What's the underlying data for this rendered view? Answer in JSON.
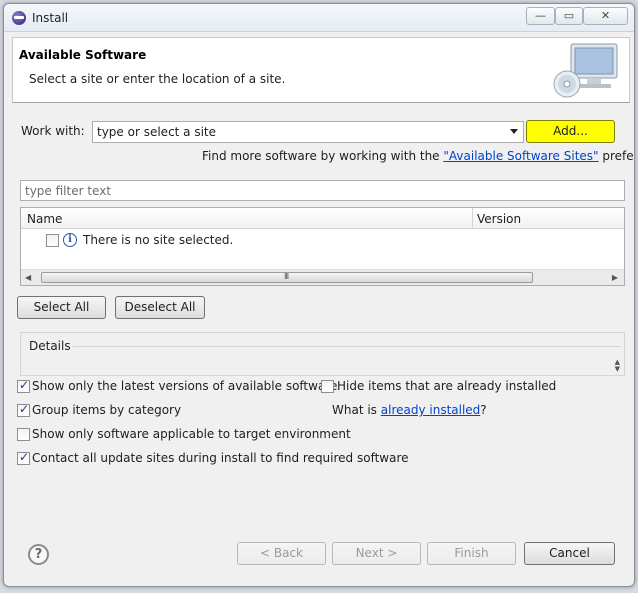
{
  "window": {
    "title": "Install",
    "minimize_glyph": "—",
    "maximize_glyph": "▭",
    "close_glyph": "✕"
  },
  "header": {
    "title": "Available Software",
    "description": "Select a site or enter the location of a site."
  },
  "work_with": {
    "label": "Work with:",
    "value": "type or select a site",
    "add_button": "Add...",
    "hint_prefix": "Find more software by working with the ",
    "hint_link": "\"Available Software Sites\"",
    "hint_suffix": " preferences."
  },
  "filter": {
    "placeholder": "type filter text"
  },
  "table": {
    "columns": [
      "Name",
      "Version"
    ],
    "empty_message": "There is no site selected.",
    "scroll_grip": "III"
  },
  "selection_buttons": {
    "select_all": "Select All",
    "deselect_all": "Deselect All"
  },
  "details": {
    "label": "Details"
  },
  "options": {
    "latest_versions": {
      "label": "Show only the latest versions of available software",
      "checked": true
    },
    "hide_installed": {
      "label": "Hide items that are already installed",
      "checked": false
    },
    "group_by_category": {
      "label": "Group items by category",
      "checked": true
    },
    "what_is_prefix": "What is ",
    "what_is_link": "already installed",
    "what_is_suffix": "?",
    "target_env": {
      "label": "Show only software applicable to target environment",
      "checked": false
    },
    "contact_sites": {
      "label": "Contact all update sites during install to find required software",
      "checked": true
    }
  },
  "footer": {
    "help_glyph": "?",
    "back": "< Back",
    "next": "Next >",
    "finish": "Finish",
    "cancel": "Cancel"
  },
  "colors": {
    "add_button_highlight": "#ffff00",
    "link": "#0044cc"
  }
}
